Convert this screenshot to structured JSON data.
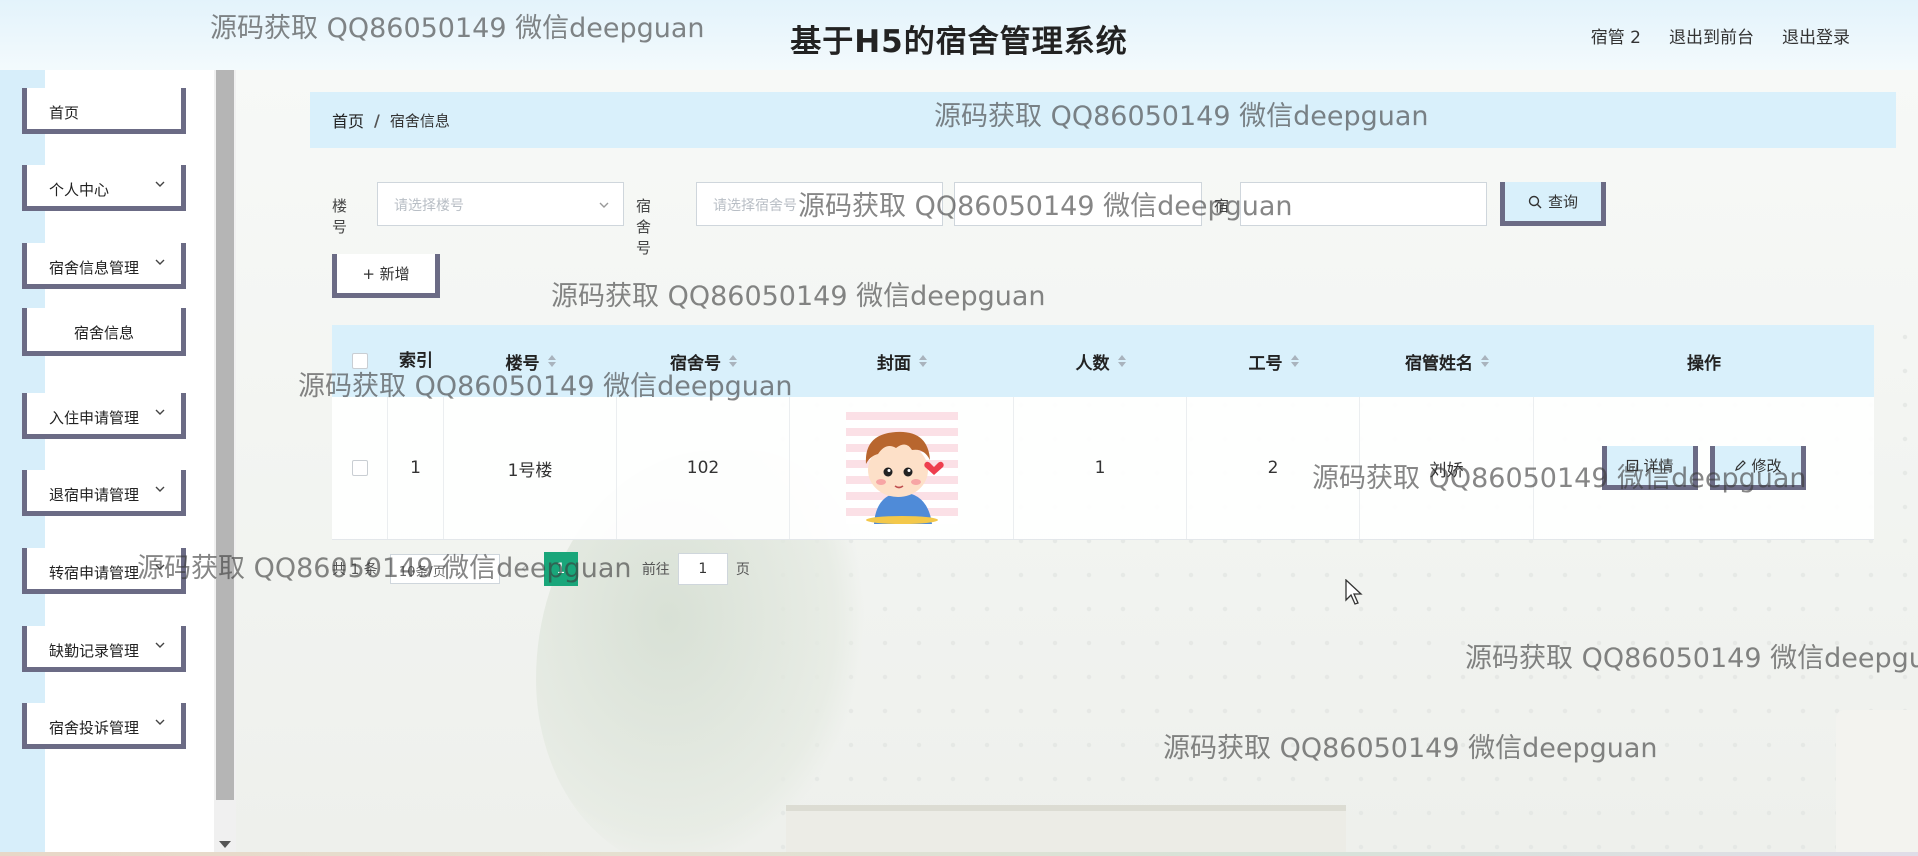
{
  "header": {
    "title": "基于H5的宿舍管理系统",
    "nav": [
      "宿管 2",
      "退出到前台",
      "退出登录"
    ]
  },
  "sidebar": {
    "items": [
      {
        "label": "首页",
        "has_chevron": false
      },
      {
        "label": "个人中心",
        "has_chevron": true
      },
      {
        "label": "宿舍信息管理",
        "has_chevron": true
      },
      {
        "label": "宿舍信息",
        "has_chevron": false,
        "sub": true
      },
      {
        "label": "入住申请管理",
        "has_chevron": true
      },
      {
        "label": "退宿申请管理",
        "has_chevron": true
      },
      {
        "label": "转宿申请管理",
        "has_chevron": true
      },
      {
        "label": "缺勤记录管理",
        "has_chevron": true
      },
      {
        "label": "宿舍投诉管理",
        "has_chevron": true
      }
    ]
  },
  "breadcrumb": {
    "home": "首页",
    "separator": "/",
    "current": "宿舍信息"
  },
  "search": {
    "building_label": "楼号",
    "building_placeholder": "请选择楼号",
    "room_label": "宿舍号",
    "room_placeholder": "请选择宿舍号",
    "extra_label": "宿",
    "query_button": "查询"
  },
  "toolbar": {
    "add_button": "+ 新增"
  },
  "table": {
    "headers": [
      "索引",
      "楼号",
      "宿舍号",
      "封面",
      "人数",
      "工号",
      "宿管姓名",
      "操作"
    ],
    "rows": [
      {
        "index": "1",
        "building": "1号楼",
        "room": "102",
        "cover": "cartoon-boy-image",
        "count": "1",
        "staff_id": "2",
        "manager": "刘娇",
        "actions": [
          "详情",
          "修改"
        ]
      }
    ]
  },
  "pagination": {
    "total": "共 1 条",
    "page_size": "10条/页",
    "current_page": "1",
    "goto_label": "前往",
    "goto_value": "1",
    "page_unit": "页"
  },
  "watermark": "源码获取 QQ86050149 微信deepguan",
  "colors": {
    "accent": "#d9f0fb",
    "border": "#6b6b85",
    "active_page": "#19a67a"
  }
}
